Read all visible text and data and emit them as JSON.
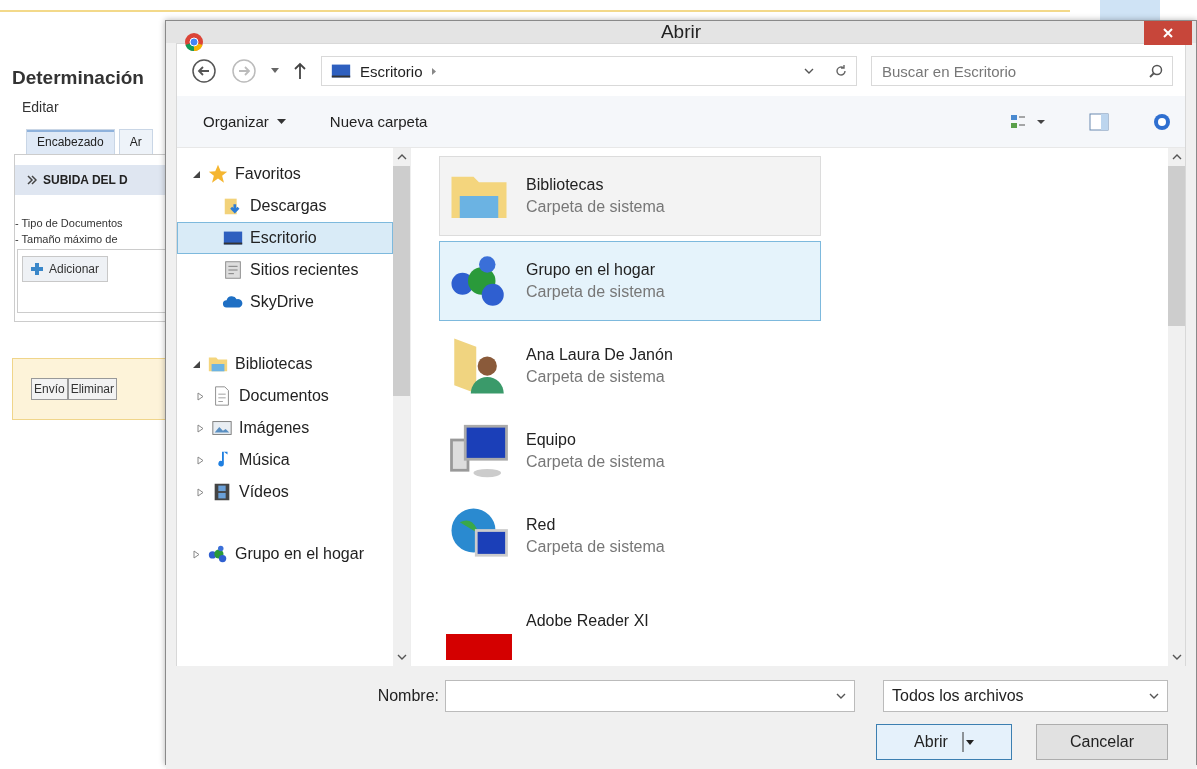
{
  "page": {
    "title": "Determinación",
    "menu": "Editar",
    "tabs": [
      {
        "label": "Encabezado",
        "selected": true
      },
      {
        "label": "Ar",
        "selected": false
      }
    ],
    "section": "SUBIDA DEL D",
    "notes": [
      "- Tipo de Documentos",
      "- Tamaño máximo de"
    ],
    "add_button": "Adicionar",
    "actions": [
      "Envío",
      "Eliminar"
    ]
  },
  "dialog": {
    "title": "Abrir",
    "address": "Escritorio",
    "search": {
      "placeholder": "Buscar en Escritorio"
    },
    "commands": [
      {
        "label": "Organizar",
        "kind": "menu"
      },
      {
        "label": "Nueva carpeta",
        "kind": "plain"
      }
    ],
    "tree": [
      {
        "label": "Favoritos",
        "kind": "star",
        "expanded": true,
        "selected": false,
        "children": [
          {
            "label": "Descargas",
            "kind": "downloads",
            "selected": false
          },
          {
            "label": "Escritorio",
            "kind": "desktop",
            "selected": true
          },
          {
            "label": "Sitios recientes",
            "kind": "recent",
            "selected": false
          },
          {
            "label": "SkyDrive",
            "kind": "cloud",
            "selected": false
          }
        ]
      },
      {
        "label": "Bibliotecas",
        "kind": "library",
        "expanded": true,
        "selected": false,
        "children": [
          {
            "label": "Documentos",
            "kind": "document",
            "expanded": false,
            "selected": false
          },
          {
            "label": "Imágenes",
            "kind": "pictures",
            "expanded": false,
            "selected": false
          },
          {
            "label": "Música",
            "kind": "music",
            "expanded": false,
            "selected": false
          },
          {
            "label": "Vídeos",
            "kind": "videos",
            "expanded": false,
            "selected": false
          }
        ]
      },
      {
        "label": "Grupo en el hogar",
        "kind": "homegroup",
        "expanded": false,
        "selected": false
      }
    ],
    "files": [
      {
        "name": "Bibliotecas",
        "type": "Carpeta de sistema",
        "kind": "library",
        "selected": false,
        "hovered": true
      },
      {
        "name": "Grupo en el hogar",
        "type": "Carpeta de sistema",
        "kind": "homegroup",
        "selected": true,
        "hovered": false
      },
      {
        "name": "Ana Laura De Janón",
        "type": "Carpeta de sistema",
        "kind": "user",
        "selected": false,
        "hovered": false
      },
      {
        "name": "Equipo",
        "type": "Carpeta de sistema",
        "kind": "computer",
        "selected": false,
        "hovered": false
      },
      {
        "name": "Red",
        "type": "Carpeta de sistema",
        "kind": "network",
        "selected": false,
        "hovered": false
      },
      {
        "name": "Adobe Reader XI",
        "kind": "pdf",
        "selected": false,
        "hovered": false
      }
    ],
    "filename_label": "Nombre:",
    "filter": "Todos los archivos",
    "buttons": [
      "Abrir",
      "Cancelar"
    ]
  }
}
